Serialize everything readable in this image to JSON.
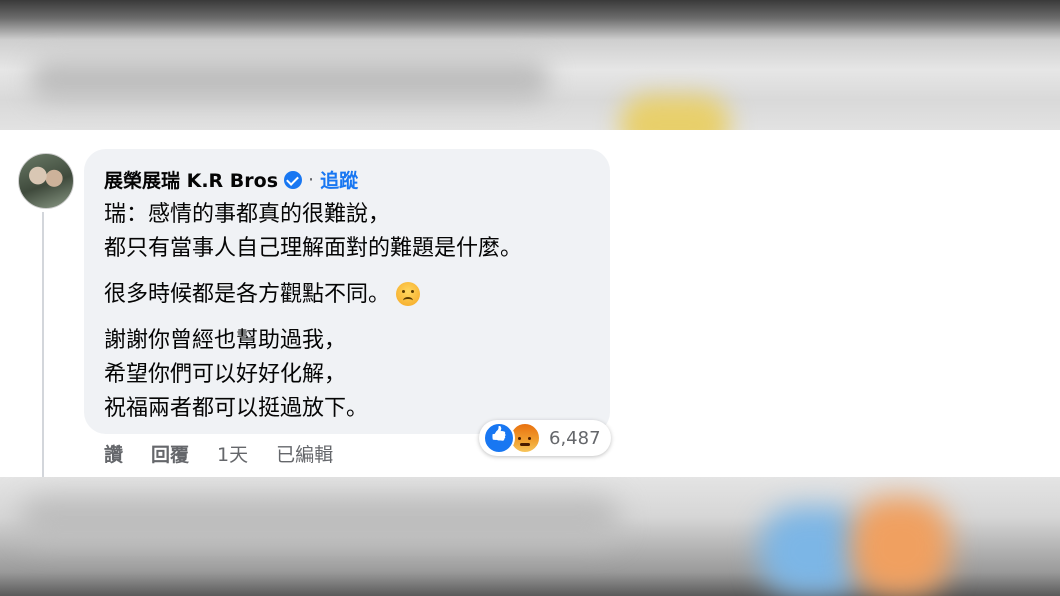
{
  "comment": {
    "author": "展榮展瑞 K.R Bros",
    "verified_icon": "verified-badge-icon",
    "separator": "·",
    "follow_label": "追蹤",
    "paragraphs": [
      [
        "瑞：感情的事都真的很難說，",
        "都只有當事人自己理解面對的難題是什麼。"
      ],
      [
        "很多時候都是各方觀點不同。"
      ],
      [
        "謝謝你曾經也幫助過我，",
        "希望你們可以好好化解，",
        "祝福兩者都可以挺過放下。"
      ]
    ],
    "emoji": "frowning-face-icon",
    "reactions": {
      "icons": [
        "like-icon",
        "angry-icon"
      ],
      "count": "6,487"
    },
    "actions": {
      "like": "讚",
      "reply": "回覆",
      "time": "1天",
      "edited": "已編輯"
    }
  },
  "colors": {
    "bubble_bg": "#f0f2f5",
    "accent": "#1877f2",
    "secondary_text": "#65676b"
  }
}
